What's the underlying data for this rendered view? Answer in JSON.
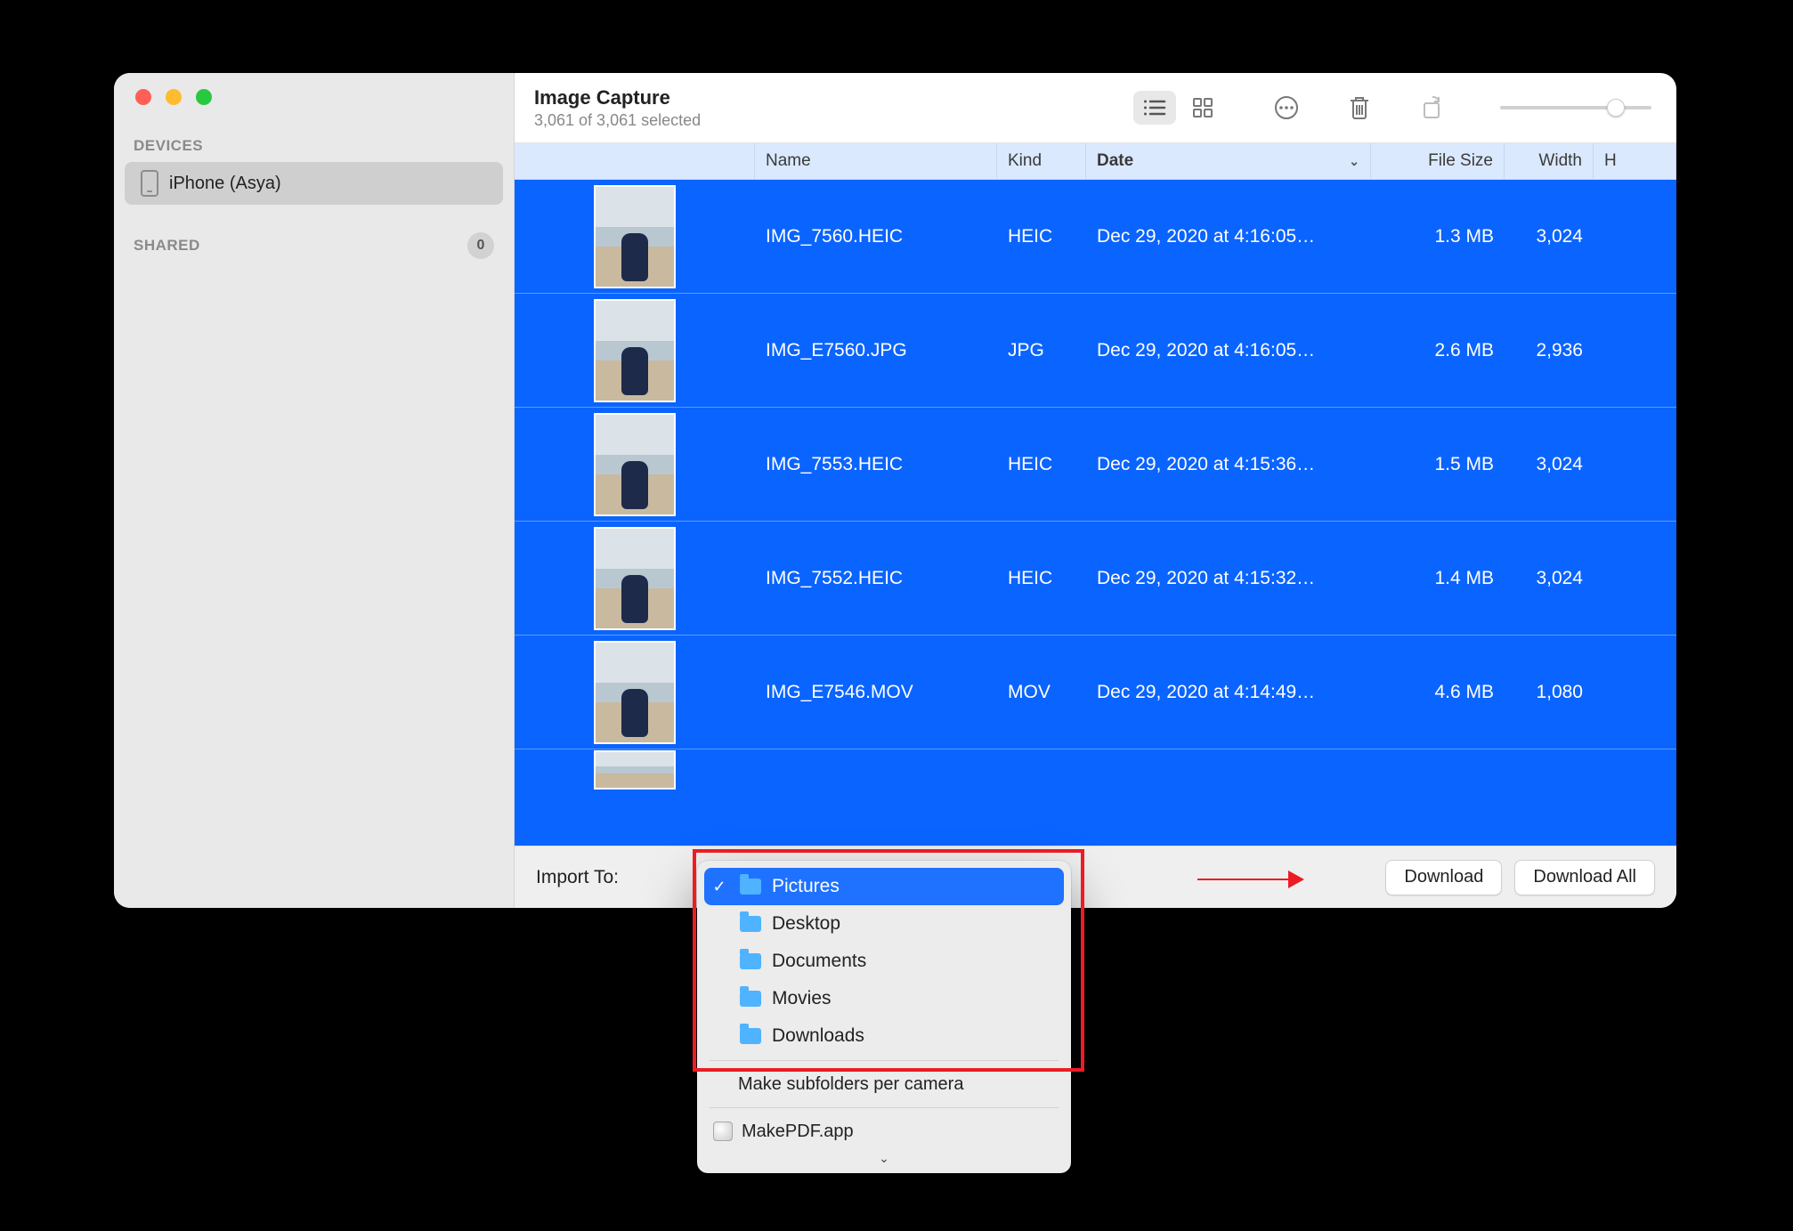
{
  "window": {
    "app_title": "Image Capture",
    "subtitle": "3,061 of 3,061 selected"
  },
  "sidebar": {
    "devices_label": "DEVICES",
    "shared_label": "SHARED",
    "shared_count": "0",
    "device_name": "iPhone (Asya)"
  },
  "columns": {
    "name": "Name",
    "kind": "Kind",
    "date": "Date",
    "file_size": "File Size",
    "width": "Width",
    "height": "H"
  },
  "rows": [
    {
      "name": "IMG_7560.HEIC",
      "kind": "HEIC",
      "date": "Dec 29, 2020 at 4:16:05…",
      "size": "1.3 MB",
      "width": "3,024"
    },
    {
      "name": "IMG_E7560.JPG",
      "kind": "JPG",
      "date": "Dec 29, 2020 at 4:16:05…",
      "size": "2.6 MB",
      "width": "2,936"
    },
    {
      "name": "IMG_7553.HEIC",
      "kind": "HEIC",
      "date": "Dec 29, 2020 at 4:15:36…",
      "size": "1.5 MB",
      "width": "3,024"
    },
    {
      "name": "IMG_7552.HEIC",
      "kind": "HEIC",
      "date": "Dec 29, 2020 at 4:15:32…",
      "size": "1.4 MB",
      "width": "3,024"
    },
    {
      "name": "IMG_E7546.MOV",
      "kind": "MOV",
      "date": "Dec 29, 2020 at 4:14:49…",
      "size": "4.6 MB",
      "width": "1,080"
    }
  ],
  "footer": {
    "import_to_label": "Import To:",
    "download": "Download",
    "download_all": "Download All"
  },
  "menu": {
    "items": [
      "Pictures",
      "Desktop",
      "Documents",
      "Movies",
      "Downloads"
    ],
    "make_subfolders": "Make subfolders per camera",
    "app": "MakePDF.app"
  }
}
